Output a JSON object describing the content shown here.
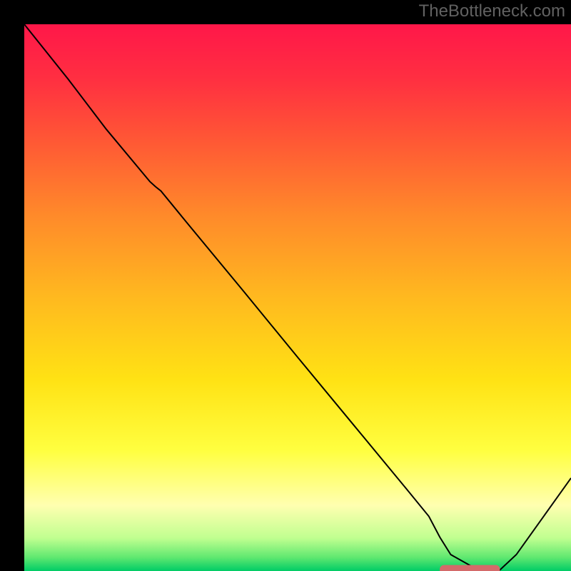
{
  "watermark": "TheBottleneck.com",
  "chart_data": {
    "type": "line",
    "title": "",
    "xlabel": "",
    "ylabel": "",
    "xlim": [
      0,
      1
    ],
    "ylim": [
      0,
      1
    ],
    "grid": false,
    "legend": false,
    "background": {
      "type": "vertical_gradient",
      "stops": [
        {
          "pos": 0.0,
          "color": "#ff1749"
        },
        {
          "pos": 0.1,
          "color": "#ff2f41"
        },
        {
          "pos": 0.2,
          "color": "#ff5336"
        },
        {
          "pos": 0.35,
          "color": "#ff8a2a"
        },
        {
          "pos": 0.5,
          "color": "#ffb91f"
        },
        {
          "pos": 0.65,
          "color": "#ffe214"
        },
        {
          "pos": 0.78,
          "color": "#ffff40"
        },
        {
          "pos": 0.88,
          "color": "#ffffb0"
        },
        {
          "pos": 0.94,
          "color": "#c0ff90"
        },
        {
          "pos": 0.975,
          "color": "#60e870"
        },
        {
          "pos": 1.0,
          "color": "#00cc66"
        }
      ]
    },
    "series": [
      {
        "name": "bottleneck-curve",
        "color": "#000000",
        "width": 2,
        "x": [
          0.0,
          0.08,
          0.15,
          0.23,
          0.24,
          0.25,
          0.3,
          0.4,
          0.5,
          0.6,
          0.7,
          0.74,
          0.76,
          0.78,
          0.83,
          0.87,
          0.9,
          0.95,
          1.0
        ],
        "values": [
          1.0,
          0.9,
          0.808,
          0.712,
          0.703,
          0.695,
          0.634,
          0.513,
          0.391,
          0.27,
          0.149,
          0.1,
          0.062,
          0.03,
          0.002,
          0.002,
          0.03,
          0.1,
          0.17
        ]
      }
    ],
    "marker": {
      "shape": "rounded-bar",
      "color": "#d46a6a",
      "x_start": 0.76,
      "x_end": 0.87,
      "y": 0.002,
      "height": 0.018
    }
  }
}
